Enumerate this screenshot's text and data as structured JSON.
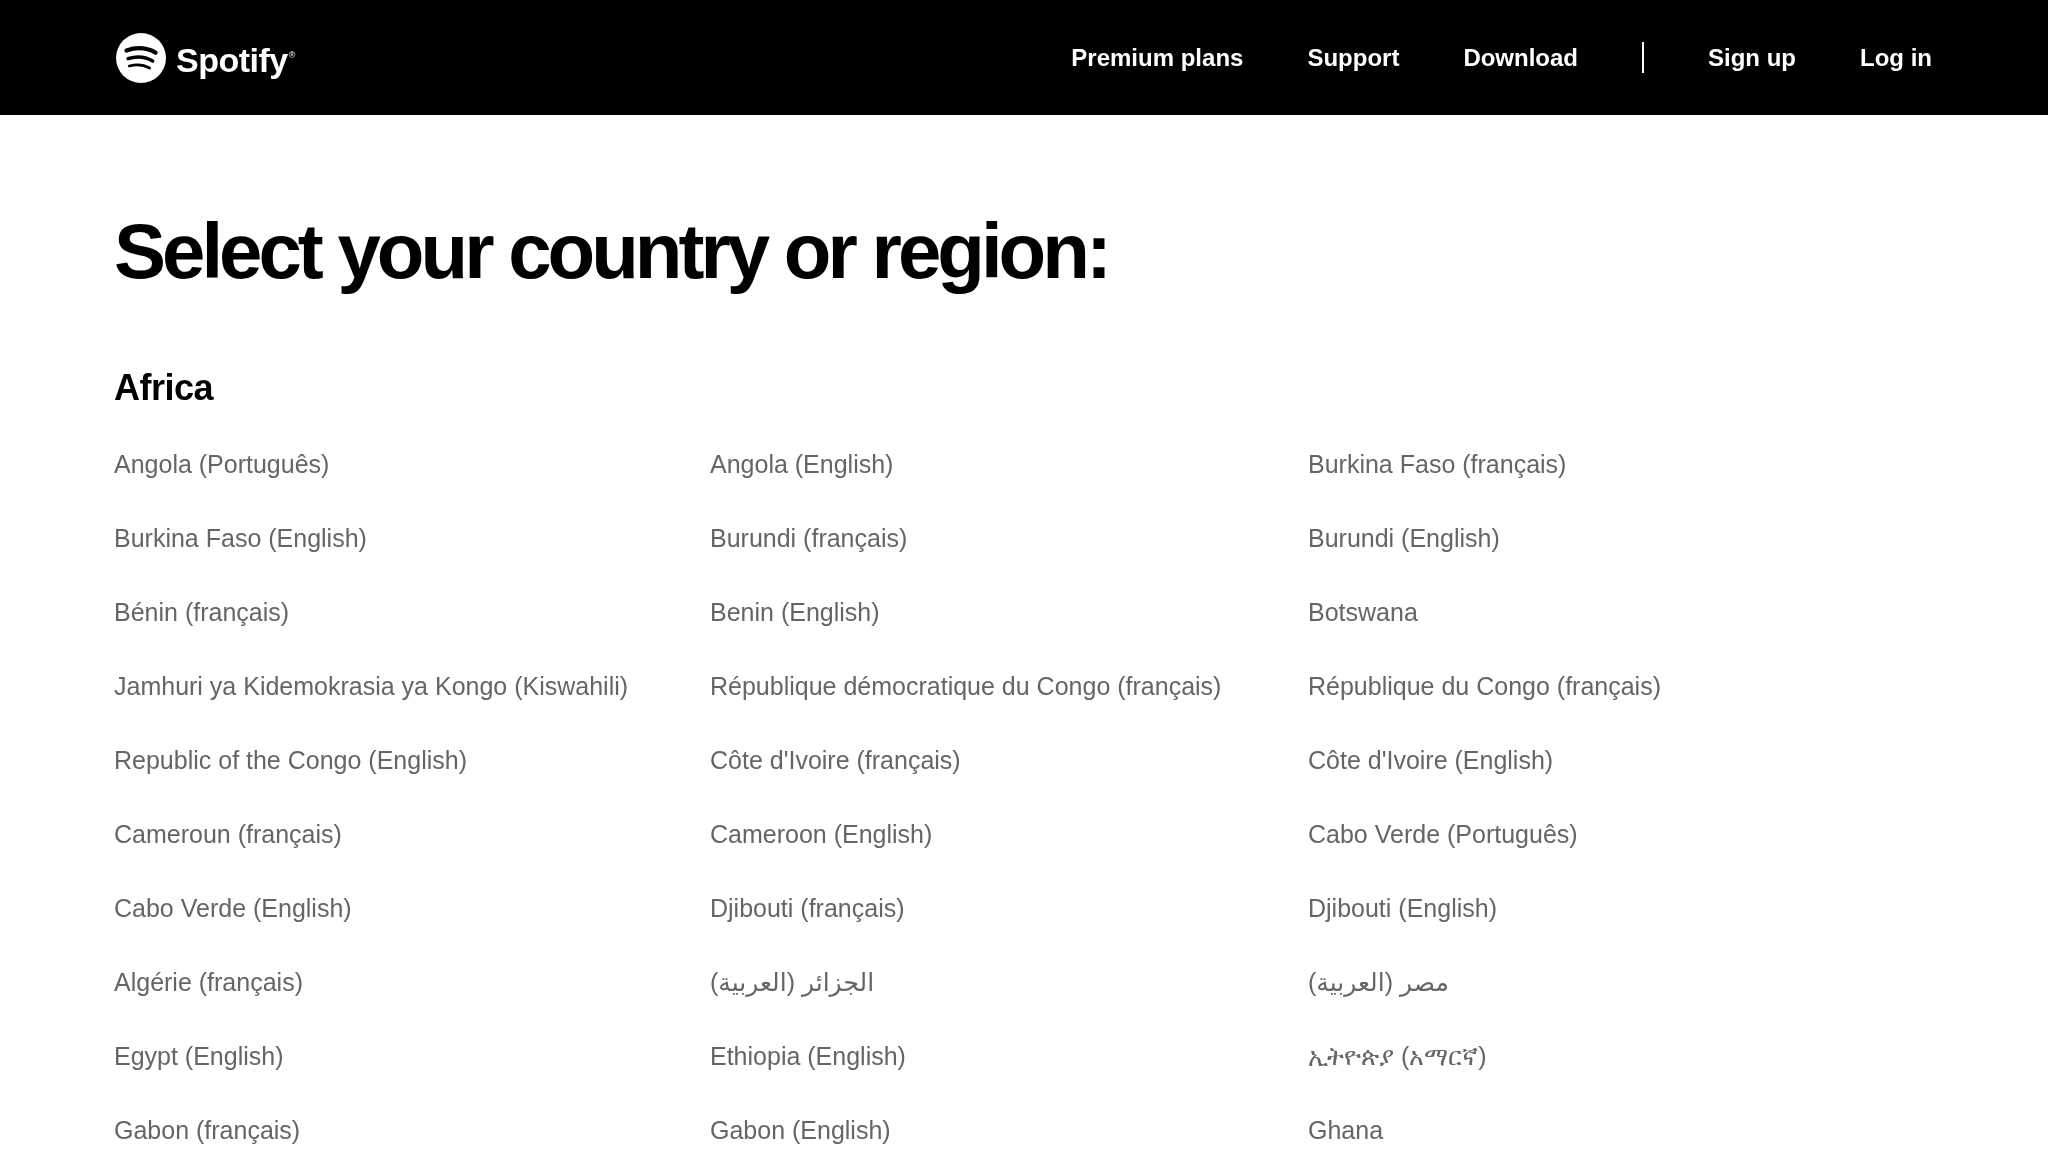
{
  "header": {
    "logo": {
      "wordmark": "Spotify$^{®}$"
    },
    "nav": [
      "Premium plans",
      "Support",
      "Download"
    ],
    "account": [
      "Sign up",
      "Log in"
    ]
  },
  "title": "Select your country or region:",
  "regions": [
    {
      "name": "Africa",
      "countries": [
        "Angola (Português)",
        "Angola (English)",
        "Burkina Faso (français)",
        "Burkina Faso (English)",
        "Burundi (français)",
        "Burundi (English)",
        "Bénin (français)",
        "Benin (English)",
        "Botswana",
        "Jamhuri ya Kidemokrasia ya Kongo (Kiswahili)",
        "République démocratique du Congo (français)",
        "République du Congo (français)",
        "Republic of the Congo (English)",
        "Côte d'Ivoire (français)",
        "Côte d'Ivoire (English)",
        "Cameroun (français)",
        "Cameroon (English)",
        "Cabo Verde (Português)",
        "Cabo Verde (English)",
        "Djibouti (français)",
        "Djibouti (English)",
        "Algérie (français)",
        "الجزائر (العربية)",
        "مصر (العربية)",
        "Egypt (English)",
        "Ethiopia (English)",
        "ኢትዮጵያ (አማርኛ)",
        "Gabon (français)",
        "Gabon (English)",
        "Ghana"
      ]
    }
  ]
}
